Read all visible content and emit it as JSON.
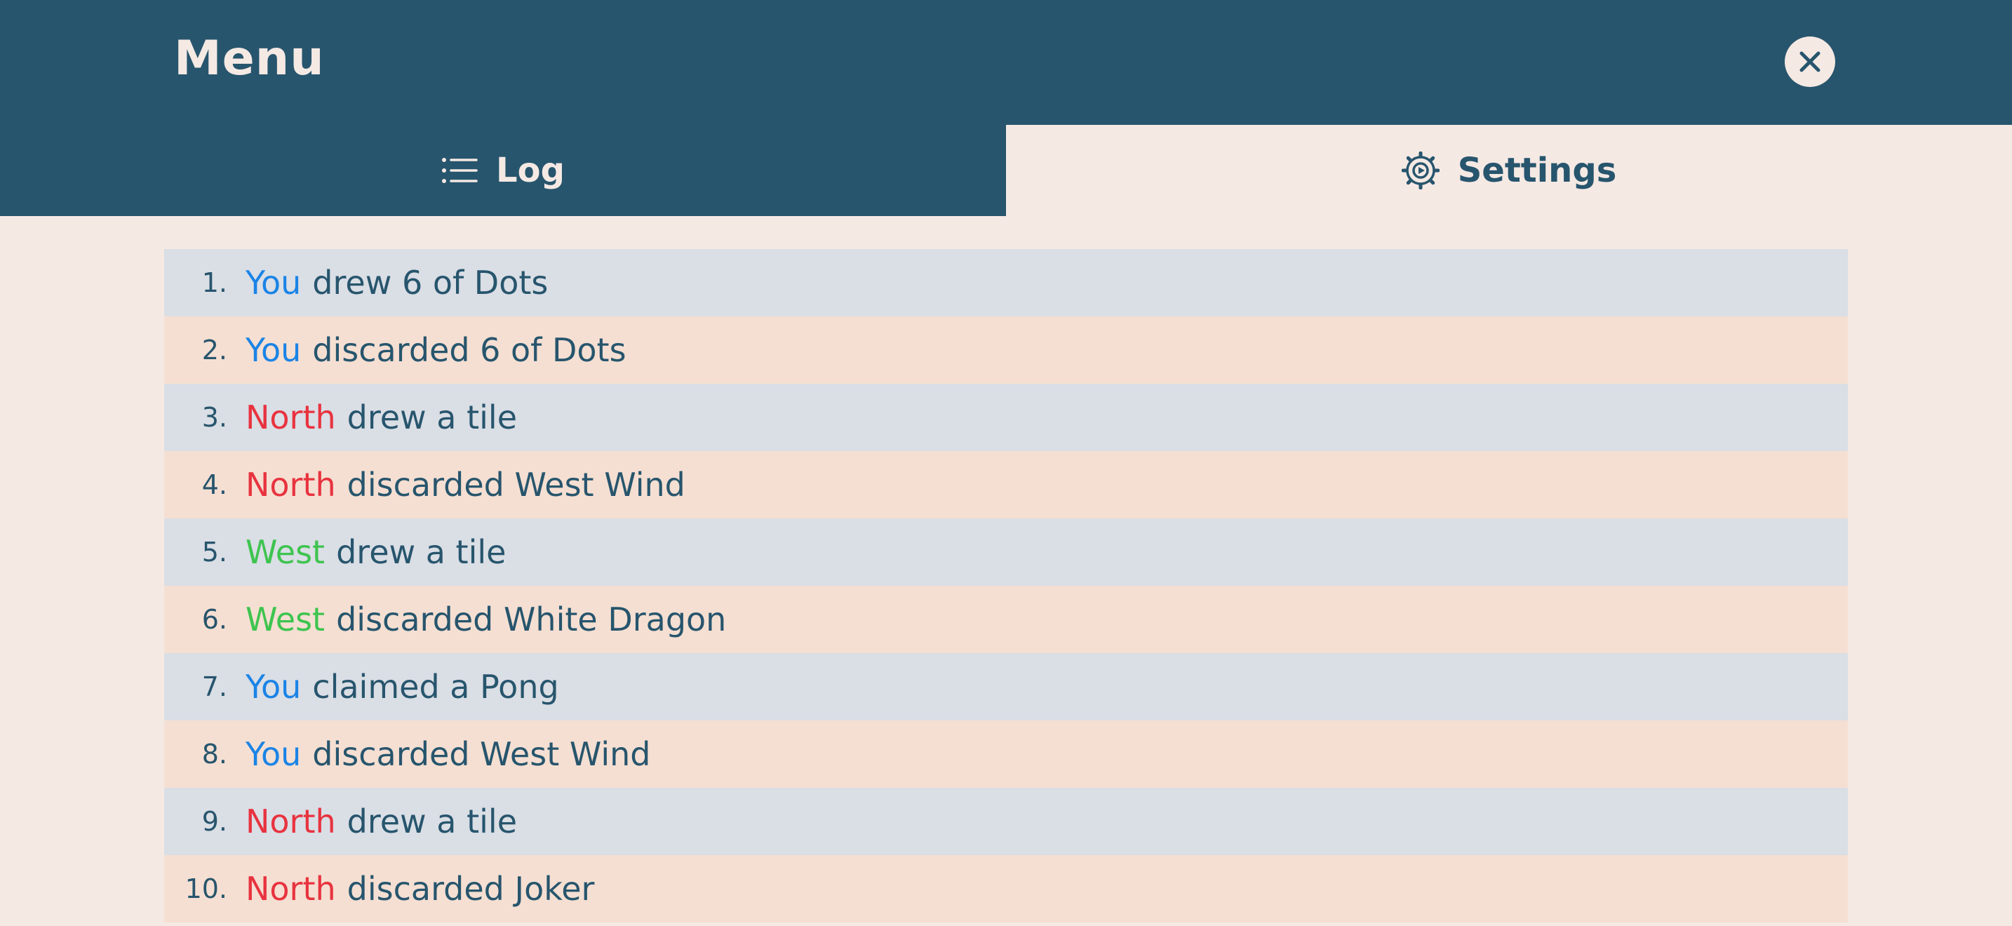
{
  "header": {
    "title": "Menu",
    "close_icon": "close-icon"
  },
  "tabs": [
    {
      "label": "Log",
      "icon": "list-icon",
      "active": true
    },
    {
      "label": "Settings",
      "icon": "gear-icon",
      "active": false
    }
  ],
  "colors": {
    "header_bg": "#27556d",
    "page_bg": "#f5e9e4",
    "row_odd": "#dadee5",
    "row_even": "#f5dfd2",
    "you": "#1b84e6",
    "north": "#e8333f",
    "west": "#3ec44f"
  },
  "log": [
    {
      "num": "1.",
      "actor": "You",
      "actor_class": "you",
      "action": "drew 6 of Dots"
    },
    {
      "num": "2.",
      "actor": "You",
      "actor_class": "you",
      "action": "discarded 6 of Dots"
    },
    {
      "num": "3.",
      "actor": "North",
      "actor_class": "north",
      "action": "drew a tile"
    },
    {
      "num": "4.",
      "actor": "North",
      "actor_class": "north",
      "action": "discarded West Wind"
    },
    {
      "num": "5.",
      "actor": "West",
      "actor_class": "west",
      "action": "drew a tile"
    },
    {
      "num": "6.",
      "actor": "West",
      "actor_class": "west",
      "action": "discarded White Dragon"
    },
    {
      "num": "7.",
      "actor": "You",
      "actor_class": "you",
      "action": "claimed a Pong"
    },
    {
      "num": "8.",
      "actor": "You",
      "actor_class": "you",
      "action": "discarded West Wind"
    },
    {
      "num": "9.",
      "actor": "North",
      "actor_class": "north",
      "action": "drew a tile"
    },
    {
      "num": "10.",
      "actor": "North",
      "actor_class": "north",
      "action": "discarded Joker"
    }
  ]
}
